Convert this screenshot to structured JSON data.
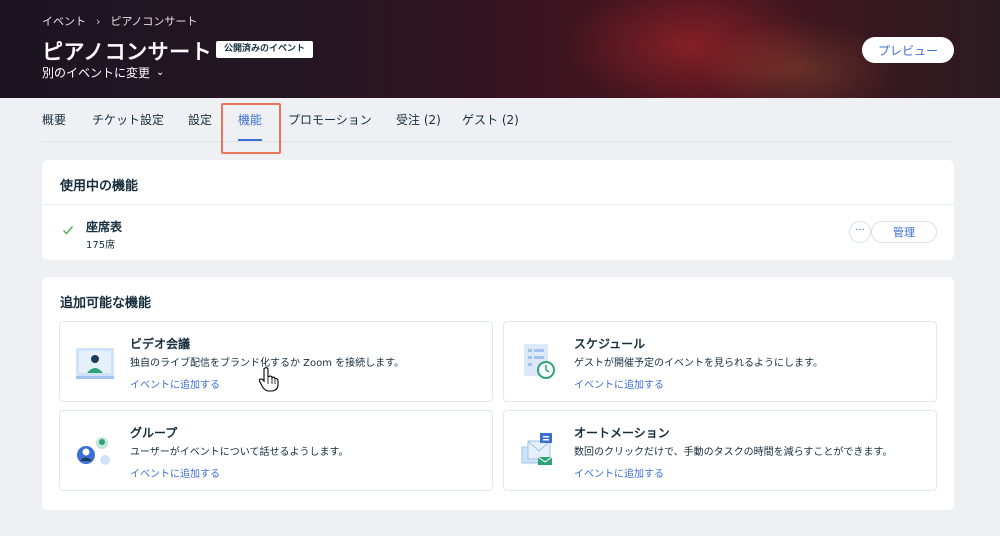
{
  "breadcrumb": {
    "root": "イベント",
    "current": "ピアノコンサート"
  },
  "header": {
    "title": "ピアノコンサート",
    "status_badge": "公開済みのイベント",
    "switch_label": "別のイベントに変更",
    "preview_label": "プレビュー"
  },
  "tabs": [
    {
      "label": "概要"
    },
    {
      "label": "チケット設定"
    },
    {
      "label": "設定"
    },
    {
      "label": "機能",
      "active": true
    },
    {
      "label": "プロモーション"
    },
    {
      "label": "受注 (2)"
    },
    {
      "label": "ゲスト (2)"
    }
  ],
  "active_features": {
    "title": "使用中の機能",
    "items": [
      {
        "name": "座席表",
        "detail": "175席",
        "more_label": "···",
        "manage_label": "管理"
      }
    ]
  },
  "available_features": {
    "title": "追加可能な機能",
    "items": [
      {
        "title": "ビデオ会議",
        "desc": "独自のライブ配信をブランド化するか Zoom を接続します。",
        "link": "イベントに追加する",
        "icon": "video-conference-icon"
      },
      {
        "title": "スケジュール",
        "desc": "ゲストが開催予定のイベントを見られるようにします。",
        "link": "イベントに追加する",
        "icon": "schedule-icon"
      },
      {
        "title": "グループ",
        "desc": "ユーザーがイベントについて話せるようします。",
        "link": "イベントに追加する",
        "icon": "group-icon"
      },
      {
        "title": "オートメーション",
        "desc": "数回のクリックだけで、手動のタスクの時間を減らすことができます。",
        "link": "イベントに追加する",
        "icon": "automation-icon"
      }
    ]
  },
  "colors": {
    "accent": "#3b6fd6",
    "highlight": "#e8765a",
    "check": "#4caf50"
  }
}
